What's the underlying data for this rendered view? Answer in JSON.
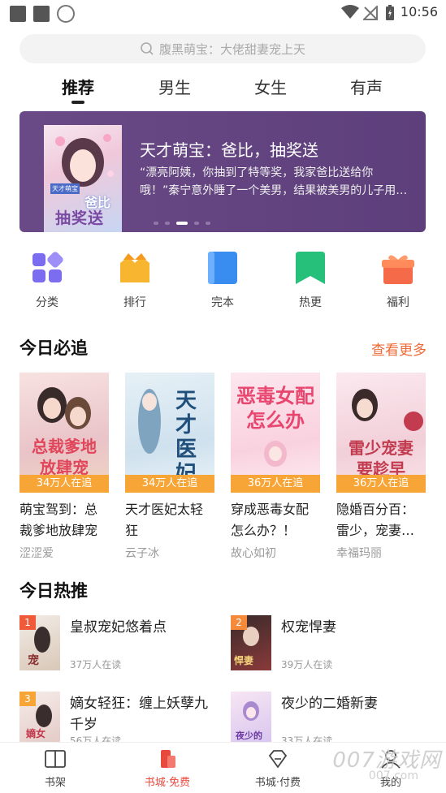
{
  "status": {
    "time": "10:56"
  },
  "search": {
    "placeholder": "腹黑萌宝：大佬甜妻宠上天"
  },
  "tabs": [
    {
      "label": "推荐",
      "active": true
    },
    {
      "label": "男生"
    },
    {
      "label": "女生"
    },
    {
      "label": "有声"
    }
  ],
  "banner": {
    "cover_text": "抽奖送",
    "cover_top": "爸比",
    "cover_tag": "天才萌宝",
    "title": "天才萌宝：爸比，抽奖送",
    "desc": "“漂亮阿姨，你抽到了特等奖，我家爸比送给你哦！”秦宁意外睡了一个美男，结果被美男的儿子用…"
  },
  "categories": [
    {
      "label": "分类",
      "icon": "grid-icon",
      "color": "#7b6cf0"
    },
    {
      "label": "排行",
      "icon": "crown-icon",
      "color": "#f8b630"
    },
    {
      "label": "完本",
      "icon": "book-icon",
      "color": "#3a8df0"
    },
    {
      "label": "热更",
      "icon": "bookmark-icon",
      "color": "#27c07b"
    },
    {
      "label": "福利",
      "icon": "gift-icon",
      "color": "#f56b4a"
    }
  ],
  "today_follow": {
    "title": "今日必追",
    "more": "查看更多",
    "books": [
      {
        "cover_text": "总裁爹地放肆宠",
        "count": "34万人在追",
        "name": "萌宝驾到：总裁爹地放肆宠",
        "author": "涩涩爱"
      },
      {
        "cover_text": "天才医妃",
        "count": "34万人在追",
        "name": "天才医妃太轻狂",
        "author": "云子冰"
      },
      {
        "cover_text": "恶毒女配怎么办",
        "count": "36万人在追",
        "name": "穿成恶毒女配怎么办？！",
        "author": "故心如初"
      },
      {
        "cover_text": "雷少宠妻要趁早",
        "count": "36万人在追",
        "name": "隐婚百分百：雷少，宠妻…",
        "author": "幸福玛丽"
      }
    ]
  },
  "today_hot": {
    "title": "今日热推",
    "items": [
      {
        "rank": "1",
        "title": "皇叔宠妃悠着点",
        "readers": "37万人在读"
      },
      {
        "rank": "2",
        "title": "权宠悍妻",
        "readers": "39万人在读"
      },
      {
        "rank": "3",
        "title": "嫡女轻狂：缠上妖孽九千岁",
        "readers": "56万人在读"
      },
      {
        "rank": "",
        "title": "夜少的二婚新妻",
        "readers": "33万人在读"
      }
    ]
  },
  "nav": [
    {
      "label": "书架",
      "icon": "bookshelf-icon"
    },
    {
      "label": "书城·免费",
      "icon": "phone-book-icon",
      "active": true
    },
    {
      "label": "书城·付费",
      "icon": "diamond-icon"
    },
    {
      "label": "我的",
      "icon": "profile-icon"
    }
  ],
  "watermark": {
    "big": "007游戏网",
    "small": "007.com"
  }
}
